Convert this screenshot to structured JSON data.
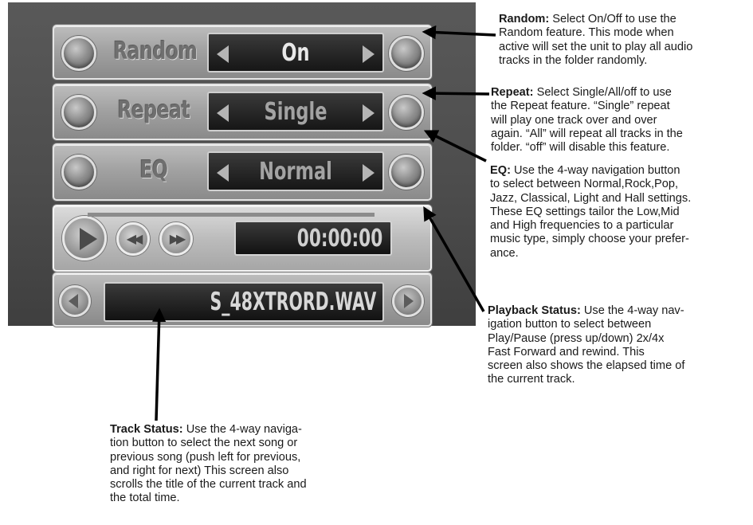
{
  "screen": {
    "random": {
      "label": "Random",
      "value": "On"
    },
    "repeat": {
      "label": "Repeat",
      "value": "Single"
    },
    "eq": {
      "label": "EQ",
      "value": "Normal"
    },
    "playback": {
      "time": "00:00:00"
    },
    "track": {
      "title": "S_48XTRORD.WAV"
    }
  },
  "annotations": {
    "random": {
      "title": "Random:",
      "lines": [
        " Select On/Off to use the",
        "Random feature. This mode when",
        "active will set the unit to play all audio",
        "tracks in the folder randomly."
      ]
    },
    "repeat": {
      "title": "Repeat:",
      "lines": [
        " Select Single/All/off to use",
        "the Repeat feature. “Single” repeat",
        "will play one track over and over",
        "again.  “All” will repeat all tracks in the",
        "folder. “off” will disable this feature."
      ]
    },
    "eq": {
      "title": "EQ:",
      "lines": [
        " Use the 4-way navigation button",
        "to select between Normal,Rock,Pop,",
        "Jazz, Classical, Light and Hall settings.",
        "These EQ settings tailor the Low,Mid",
        "and High frequencies to a particular",
        "music type, simply choose your prefer-",
        "ance."
      ]
    },
    "playback": {
      "title": "Playback Status:",
      "lines": [
        " Use the 4-way nav-",
        "igation button to select between",
        "Play/Pause (press up/down)  2x/4x",
        "Fast Forward and rewind.  This",
        "screen also shows the elapsed time of",
        "the current track."
      ]
    },
    "track": {
      "title": "Track Status:",
      "lines": [
        " Use the 4-way naviga-",
        "tion button to select the next song or",
        "previous song (push left for previous,",
        "and right for next)  This screen also",
        "scrolls the title of the current track and",
        "the total time."
      ]
    }
  }
}
